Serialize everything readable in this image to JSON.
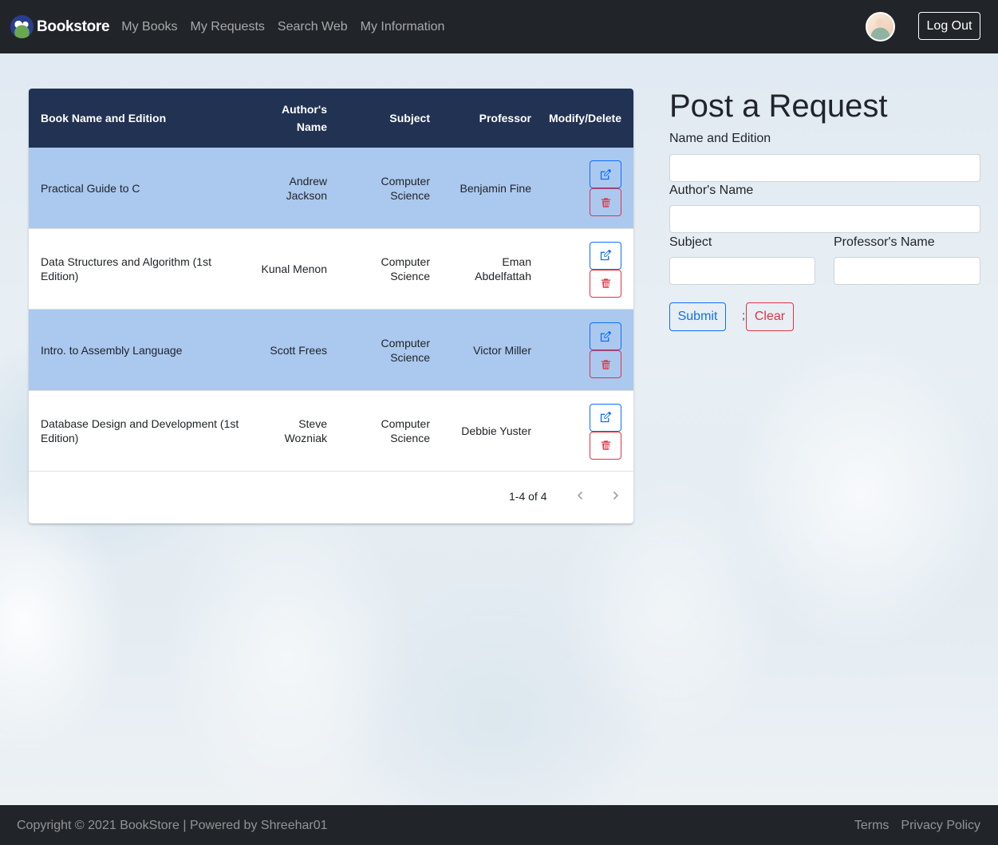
{
  "navbar": {
    "brand": "Bookstore",
    "links": [
      "My Books",
      "My Requests",
      "Search Web",
      "My Information"
    ],
    "logout": "Log Out"
  },
  "table": {
    "headers": {
      "book": "Book Name and Edition",
      "author": "Author's Name",
      "subject": "Subject",
      "professor": "Professor",
      "actions": "Modify/Delete"
    },
    "rows": [
      {
        "book": "Practical Guide to C",
        "author": "Andrew Jackson",
        "subject": "Computer Science",
        "professor": "Benjamin Fine"
      },
      {
        "book": "Data Structures and Algorithm (1st Edition)",
        "author": "Kunal Menon",
        "subject": "Computer Science",
        "professor": "Eman Abdelfattah"
      },
      {
        "book": "Intro. to Assembly Language",
        "author": "Scott Frees",
        "subject": "Computer Science",
        "professor": "Victor Miller"
      },
      {
        "book": "Database Design and Development (1st Edition)",
        "author": "Steve Wozniak",
        "subject": "Computer Science",
        "professor": "Debbie Yuster"
      }
    ],
    "pagination": "1-4 of 4"
  },
  "form": {
    "title": "Post a Request",
    "name_label": "Name and Edition",
    "author_label": "Author's Name",
    "subject_label": "Subject",
    "professor_label": "Professor's Name",
    "submit": "Submit",
    "separator": ";",
    "clear": "Clear"
  },
  "footer": {
    "copyright": "Copyright © 2021 BookStore | Powered by Shreehar01",
    "links": [
      "Terms",
      "Privacy Policy"
    ]
  },
  "colors": {
    "navbar": "#212529",
    "table_header": "#213253",
    "row_highlight": "#abc8ef",
    "primary": "#0d6efd",
    "danger": "#dc3545"
  },
  "icons": {
    "brand": "globe-logo-icon",
    "edit": "pencil-square-icon",
    "delete": "trash-icon",
    "prev": "chevron-left-icon",
    "next": "chevron-right-icon"
  }
}
